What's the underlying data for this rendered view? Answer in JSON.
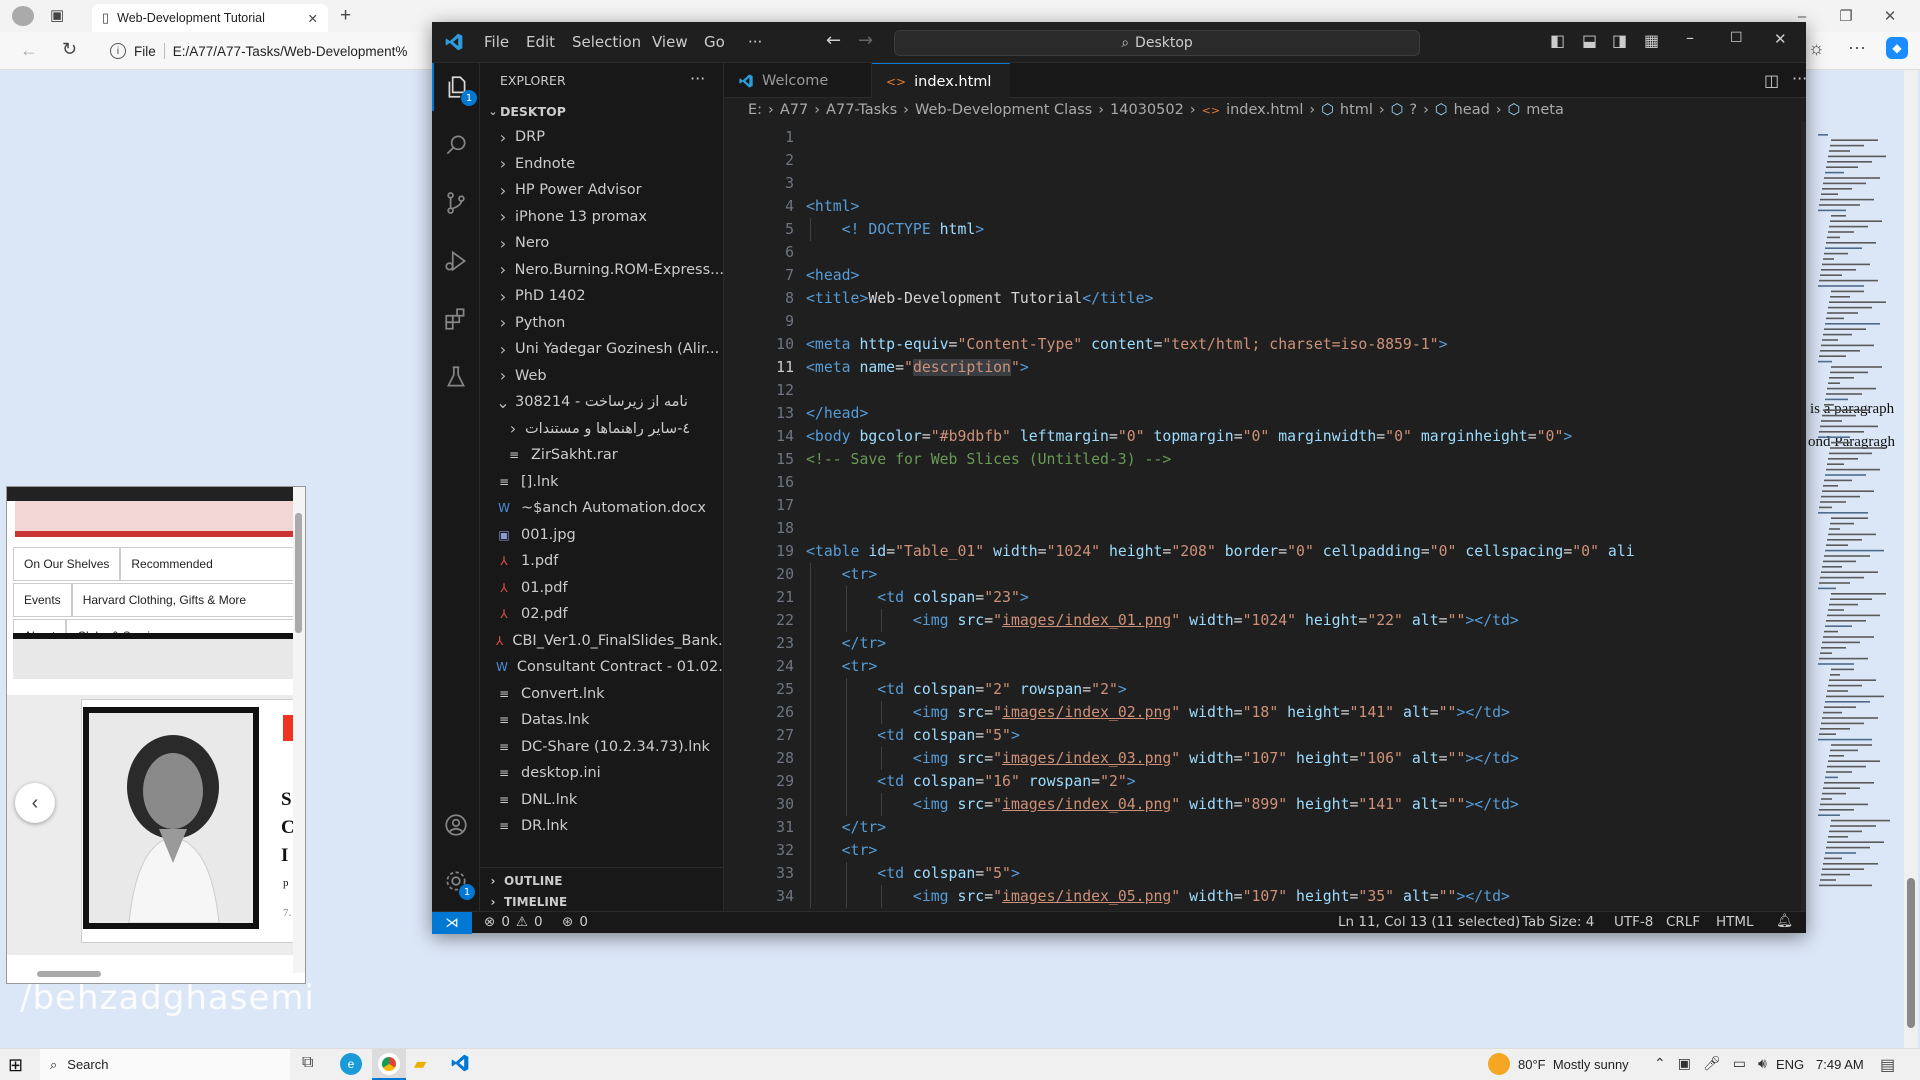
{
  "browser": {
    "tab_title": "Web-Development Tutorial",
    "address_prefix": "File",
    "address_url": "E:/A77/A77-Tasks/Web-Development%",
    "page_text_right": [
      "is a paragraph",
      "ond Paragragh"
    ],
    "page_widget": {
      "nav_row1": [
        "On Our Shelves",
        "Recommended"
      ],
      "nav_row2": [
        "Events",
        "Harvard Clothing, Gifts & More"
      ],
      "nav_row3": [
        "About",
        "Clubs & Services"
      ],
      "letters": [
        "S",
        "C",
        "I",
        "p",
        "7."
      ]
    },
    "watermark": "/behzadghasemi"
  },
  "vscode": {
    "menu": [
      "File",
      "Edit",
      "Selection",
      "View",
      "Go",
      "···"
    ],
    "search_placeholder": "Desktop",
    "explorer_title": "EXPLORER",
    "root_folder": "DESKTOP",
    "tree": [
      {
        "label": "DRP",
        "type": "folder",
        "depth": 1,
        "open": false
      },
      {
        "label": "Endnote",
        "type": "folder",
        "depth": 1,
        "open": false
      },
      {
        "label": "HP Power Advisor",
        "type": "folder",
        "depth": 1,
        "open": false
      },
      {
        "label": "iPhone 13 promax",
        "type": "folder",
        "depth": 1,
        "open": false
      },
      {
        "label": "Nero",
        "type": "folder",
        "depth": 1,
        "open": false
      },
      {
        "label": "Nero.Burning.ROM-Express...",
        "type": "folder",
        "depth": 1,
        "open": false
      },
      {
        "label": "PhD 1402",
        "type": "folder",
        "depth": 1,
        "open": false
      },
      {
        "label": "Python",
        "type": "folder",
        "depth": 1,
        "open": false
      },
      {
        "label": "Uni Yadegar Gozinesh (Alir...",
        "type": "folder",
        "depth": 1,
        "open": false
      },
      {
        "label": "Web",
        "type": "folder",
        "depth": 1,
        "open": false
      },
      {
        "label": "308214 - نامه از زیرساخت",
        "type": "folder",
        "depth": 1,
        "open": true
      },
      {
        "label": "٤-سایر راهنماها و مستندات",
        "type": "folder",
        "depth": 2,
        "open": false
      },
      {
        "label": "ZirSakht.rar",
        "type": "file",
        "depth": 2,
        "icon": "≡"
      },
      {
        "label": "[].lnk",
        "type": "file",
        "depth": 1,
        "icon": "≡"
      },
      {
        "label": "~$anch Automation.docx",
        "type": "file",
        "depth": 1,
        "icon": "W"
      },
      {
        "label": "001.jpg",
        "type": "file",
        "depth": 1,
        "icon": "▣"
      },
      {
        "label": "1.pdf",
        "type": "file",
        "depth": 1,
        "icon": "⅄"
      },
      {
        "label": "01.pdf",
        "type": "file",
        "depth": 1,
        "icon": "⅄"
      },
      {
        "label": "02.pdf",
        "type": "file",
        "depth": 1,
        "icon": "⅄"
      },
      {
        "label": "CBI_Ver1.0_FinalSlides_Bank...",
        "type": "file",
        "depth": 1,
        "icon": "⅄"
      },
      {
        "label": "Consultant Contract - 01.02...",
        "type": "file",
        "depth": 1,
        "icon": "W"
      },
      {
        "label": "Convert.lnk",
        "type": "file",
        "depth": 1,
        "icon": "≡"
      },
      {
        "label": "Datas.lnk",
        "type": "file",
        "depth": 1,
        "icon": "≡"
      },
      {
        "label": "DC-Share (10.2.34.73).lnk",
        "type": "file",
        "depth": 1,
        "icon": "≡"
      },
      {
        "label": "desktop.ini",
        "type": "file",
        "depth": 1,
        "icon": "≡"
      },
      {
        "label": "DNL.lnk",
        "type": "file",
        "depth": 1,
        "icon": "≡"
      },
      {
        "label": "DR.lnk",
        "type": "file",
        "depth": 1,
        "icon": "≡"
      }
    ],
    "outline_label": "OUTLINE",
    "timeline_label": "TIMELINE",
    "tabs": [
      {
        "label": "Welcome",
        "active": false
      },
      {
        "label": "index.html",
        "active": true,
        "modified": true
      }
    ],
    "breadcrumb": [
      "E:",
      "A77",
      "A77-Tasks",
      "Web-Development Class",
      "14030502",
      "index.html",
      "html",
      "?",
      "head",
      "meta"
    ],
    "active_line": 11,
    "code_lines": [
      "",
      "",
      "",
      "<html>",
      "    <! DOCTYPE html>",
      "",
      "<head>",
      "<title>Web-Development Tutorial</title>",
      "",
      "<meta http-equiv=\"Content-Type\" content=\"text/html; charset=iso-8859-1\">",
      "<meta name=\"description\">",
      "",
      "</head>",
      "<body bgcolor=\"#b9dbfb\" leftmargin=\"0\" topmargin=\"0\" marginwidth=\"0\" marginheight=\"0\">",
      "<!-- Save for Web Slices (Untitled-3) -->",
      "",
      "",
      "",
      "<table id=\"Table_01\" width=\"1024\" height=\"208\" border=\"0\" cellpadding=\"0\" cellspacing=\"0\" ali",
      "    <tr>",
      "        <td colspan=\"23\">",
      "            <img src=\"images/index_01.png\" width=\"1024\" height=\"22\" alt=\"\"></td>",
      "    </tr>",
      "    <tr>",
      "        <td colspan=\"2\" rowspan=\"2\">",
      "            <img src=\"images/index_02.png\" width=\"18\" height=\"141\" alt=\"\"></td>",
      "        <td colspan=\"5\">",
      "            <img src=\"images/index_03.png\" width=\"107\" height=\"106\" alt=\"\"></td>",
      "        <td colspan=\"16\" rowspan=\"2\">",
      "            <img src=\"images/index_04.png\" width=\"899\" height=\"141\" alt=\"\"></td>",
      "    </tr>",
      "    <tr>",
      "        <td colspan=\"5\">",
      "            <img src=\"images/index_05.png\" width=\"107\" height=\"35\" alt=\"\"></td>"
    ],
    "status": {
      "errors": "0",
      "warnings": "0",
      "ports": "0",
      "position": "Ln 11, Col 13 (11 selected)",
      "tab_size": "Tab Size: 4",
      "encoding": "UTF-8",
      "eol": "CRLF",
      "language": "HTML"
    },
    "badges": {
      "explorer": "1",
      "settings": "1"
    }
  },
  "taskbar": {
    "search": "Search",
    "weather": "80°F  Mostly sunny",
    "lang": "ENG",
    "time": "7:49 AM"
  },
  "colors": {
    "accent": "#0078d4",
    "editor_bg": "#1f1f1f",
    "page_bg": "#dbe6f7"
  }
}
